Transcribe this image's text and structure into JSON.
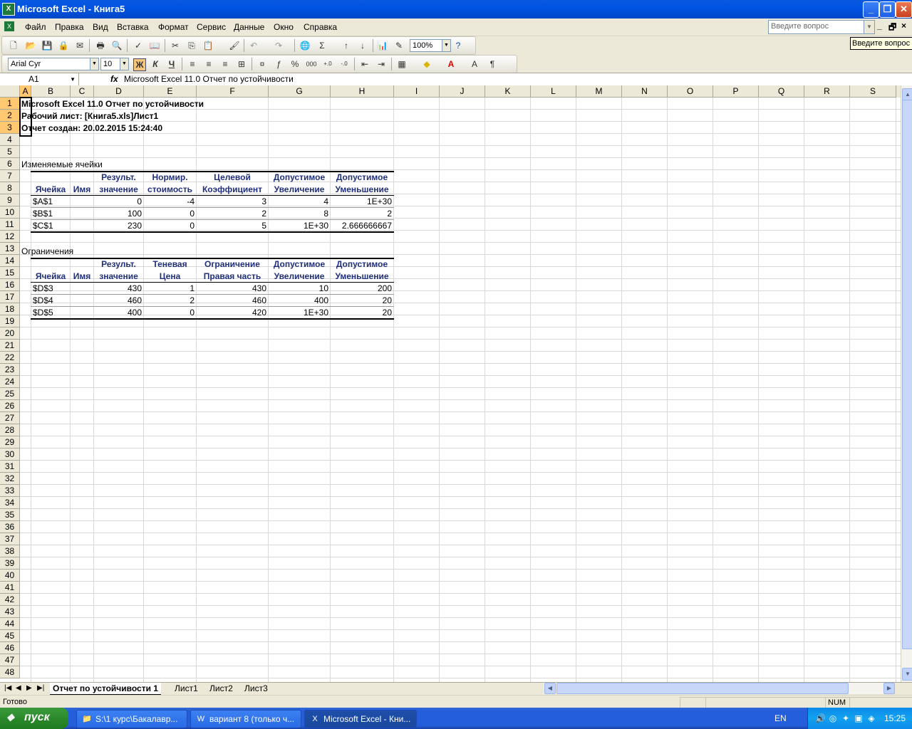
{
  "window": {
    "title": "Microsoft Excel - Книга5",
    "app_icon": "excel-icon"
  },
  "menu": {
    "items": [
      "Файл",
      "Правка",
      "Вид",
      "Вставка",
      "Формат",
      "Сервис",
      "Данные",
      "Окно",
      "Справка"
    ],
    "help_placeholder": "Введите вопрос",
    "help_tooltip": "Введите вопрос"
  },
  "toolbar": {
    "zoom": "100%",
    "font_name": "Arial Cyr",
    "font_size": "10",
    "bold": "Ж",
    "italic": "К",
    "underline": "Ч"
  },
  "formula_bar": {
    "name_box": "A1",
    "fx": "fx",
    "formula": "Microsoft Excel 11.0 Отчет по устойчивости"
  },
  "columns": [
    "A",
    "B",
    "C",
    "D",
    "E",
    "F",
    "G",
    "H",
    "I",
    "J",
    "K",
    "L",
    "M",
    "N",
    "O",
    "P",
    "Q",
    "R",
    "S"
  ],
  "rows": [
    "1",
    "2",
    "3",
    "4",
    "5",
    "6",
    "7",
    "8",
    "9",
    "10",
    "11",
    "12",
    "13",
    "14",
    "15",
    "16",
    "17",
    "18",
    "19",
    "20",
    "21",
    "22",
    "23",
    "24",
    "25",
    "26",
    "27",
    "28",
    "29",
    "30",
    "31",
    "32",
    "33",
    "34",
    "35",
    "36",
    "37",
    "38",
    "39",
    "40",
    "41",
    "42",
    "43",
    "44",
    "45",
    "46",
    "47",
    "48"
  ],
  "selected_cell": "A1",
  "report": {
    "line1": "Microsoft Excel 11.0 Отчет по устойчивости",
    "line2": "Рабочий лист: [Книга5.xls]Лист1",
    "line3": "Отчет создан: 20.02.2015 15:24:40",
    "changing_cells_title": "Изменяемые ячейки",
    "changing_cells": {
      "headers_top": [
        "",
        "",
        "Результ.",
        "Нормир.",
        "Целевой",
        "Допустимое",
        "Допустимое"
      ],
      "headers_bottom": [
        "Ячейка",
        "Имя",
        "значение",
        "стоимость",
        "Коэффициент",
        "Увеличение",
        "Уменьшение"
      ],
      "rows": [
        [
          "$A$1",
          "",
          "0",
          "-4",
          "3",
          "4",
          "1E+30"
        ],
        [
          "$B$1",
          "",
          "100",
          "0",
          "2",
          "8",
          "2"
        ],
        [
          "$C$1",
          "",
          "230",
          "0",
          "5",
          "1E+30",
          "2.666666667"
        ]
      ]
    },
    "constraints_title": "Ограничения",
    "constraints": {
      "headers_top": [
        "",
        "",
        "Результ.",
        "Теневая",
        "Ограничение",
        "Допустимое",
        "Допустимое"
      ],
      "headers_bottom": [
        "Ячейка",
        "Имя",
        "значение",
        "Цена",
        "Правая часть",
        "Увеличение",
        "Уменьшение"
      ],
      "rows": [
        [
          "$D$3",
          "",
          "430",
          "1",
          "430",
          "10",
          "200"
        ],
        [
          "$D$4",
          "",
          "460",
          "2",
          "460",
          "400",
          "20"
        ],
        [
          "$D$5",
          "",
          "400",
          "0",
          "420",
          "1E+30",
          "20"
        ]
      ]
    }
  },
  "sheets": {
    "tabs": [
      "Отчет по устойчивости 1",
      "Лист1",
      "Лист2",
      "Лист3"
    ],
    "active": "Отчет по устойчивости 1"
  },
  "status": {
    "ready": "Готово",
    "num": "NUM"
  },
  "taskbar": {
    "start": "пуск",
    "tasks": [
      "S:\\1 курс\\Бакалавр...",
      "вариант 8 (только ч...",
      "Microsoft Excel - Кни..."
    ],
    "lang": "EN",
    "clock": "15:25"
  },
  "colors": {
    "title_blue": "#0054e3",
    "header_text_blue": "#1f2f7c",
    "selected_header": "#ffc871"
  }
}
